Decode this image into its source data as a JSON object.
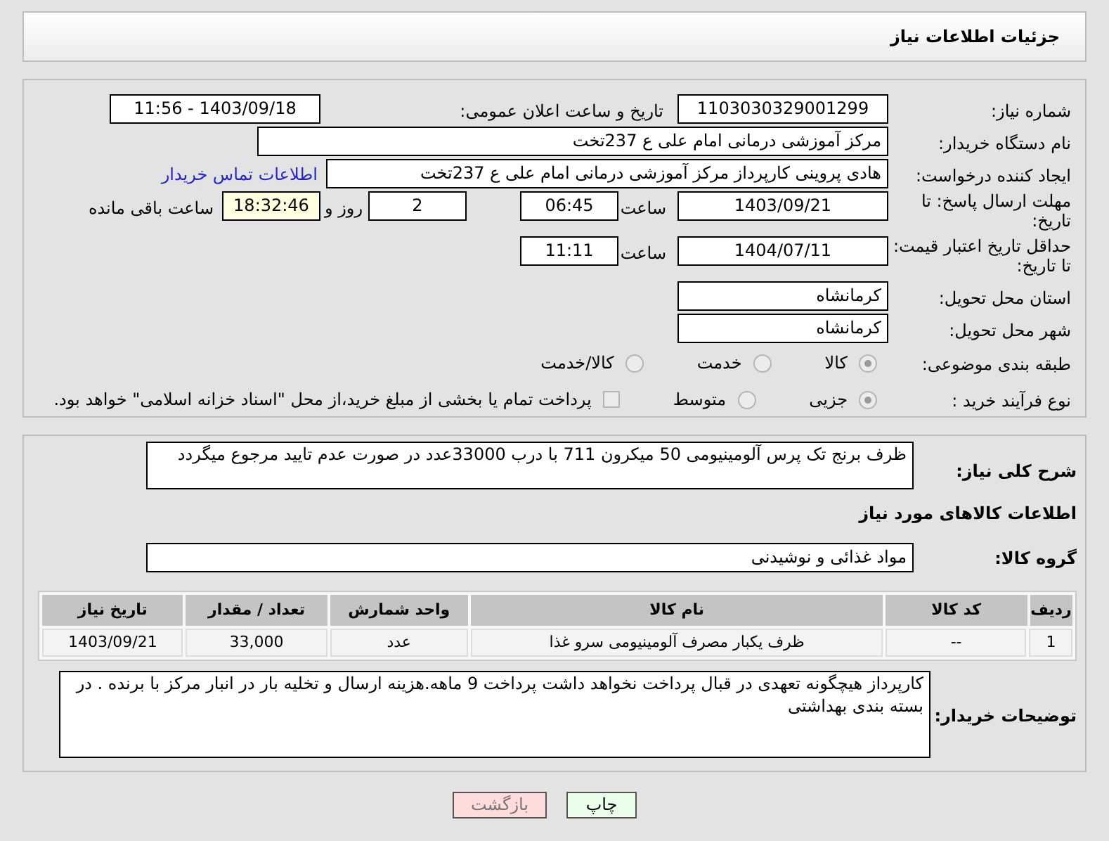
{
  "header": {
    "title": "جزئیات اطلاعات نیاز"
  },
  "need_number": {
    "label": "شماره نیاز:",
    "value": "1103030329001299"
  },
  "announce": {
    "label": "تاریخ و ساعت اعلان عمومی:",
    "value": "1403/09/18 - 11:56"
  },
  "buyer_org": {
    "label": "نام دستگاه خریدار:",
    "value": "مرکز آموزشی درمانی امام علی ع 237تخت"
  },
  "requester": {
    "label": "ایجاد کننده درخواست:",
    "value": "هادی پروینی کارپرداز  مرکز آموزشی درمانی امام علی ع 237تخت",
    "link": "اطلاعات تماس خریدار"
  },
  "deadline": {
    "label": "مهلت ارسال پاسخ: تا تاریخ:",
    "date": "1403/09/21",
    "time_label": "ساعت",
    "time": "06:45",
    "days": "2",
    "days_label": "روز و",
    "remaining": "18:32:46",
    "remaining_label": "ساعت باقی مانده"
  },
  "validity": {
    "label": "حداقل تاریخ اعتبار قیمت: تا تاریخ:",
    "date": "1404/07/11",
    "time_label": "ساعت",
    "time": "11:11"
  },
  "province": {
    "label": "استان محل تحویل:",
    "value": "کرمانشاه"
  },
  "city": {
    "label": "شهر محل تحویل:",
    "value": "کرمانشاه"
  },
  "category": {
    "label": "طبقه بندی موضوعی:",
    "options": [
      {
        "label": "کالا",
        "selected": true
      },
      {
        "label": "خدمت",
        "selected": false
      },
      {
        "label": "کالا/خدمت",
        "selected": false
      }
    ]
  },
  "process": {
    "label": "نوع فرآیند خرید :",
    "options": [
      {
        "label": "جزیی",
        "selected": true
      },
      {
        "label": "متوسط",
        "selected": false
      }
    ],
    "checkbox": {
      "label": "پرداخت تمام یا بخشی از مبلغ خرید،از محل \"اسناد خزانه اسلامی\" خواهد بود.",
      "checked": false
    }
  },
  "description": {
    "label": "شرح کلی نیاز:",
    "value": "ظرف  برنج تک پرس آلومینیومی 50 میکرون 711 با درب 33000عدد در صورت عدم تایید مرجوع میگردد"
  },
  "goods_heading": "اطلاعات کالاهای مورد نیاز",
  "goods_group": {
    "label": "گروه کالا:",
    "value": "مواد غذائی و نوشیدنی"
  },
  "table": {
    "columns": [
      "ردیف",
      "کد کالا",
      "نام کالا",
      "واحد شمارش",
      "تعداد / مقدار",
      "تاریخ نیاز"
    ],
    "rows": [
      [
        "1",
        "--",
        "ظرف یکبار مصرف آلومینیومی سرو غذا",
        "عدد",
        "33,000",
        "1403/09/21"
      ]
    ]
  },
  "buyer_notes": {
    "label": "توضیحات خریدار:",
    "value": "کارپرداز هیچگونه تعهدی در قبال پرداخت نخواهد داشت  پرداخت 9 ماهه.هزینه ارسال و تخلیه بار در انبار مرکز با برنده . در بسته بندی بهداشتی"
  },
  "buttons": [
    {
      "label": "چاپ",
      "kind": "print"
    },
    {
      "label": "بازگشت",
      "kind": "back"
    }
  ]
}
